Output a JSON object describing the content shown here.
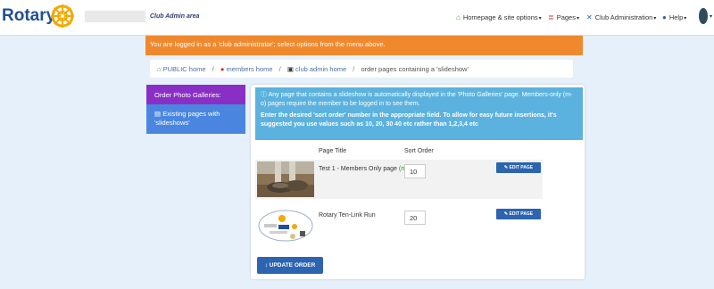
{
  "header": {
    "logo_text": "Rotary",
    "area_label": "Club Admin area",
    "nav": [
      {
        "label": "Homepage & site options",
        "icon": "home-icon"
      },
      {
        "label": "Pages",
        "icon": "stack-icon"
      },
      {
        "label": "Club Administration",
        "icon": "wrench-icon"
      },
      {
        "label": "Help",
        "icon": "question-icon"
      }
    ],
    "colors": {
      "brand": "#1f4e96",
      "wheel": "#f2a900"
    }
  },
  "banner": {
    "text": "You are logged in as a 'club administrator'; select options from the menu above.",
    "color": "#f0892e"
  },
  "breadcrumb": {
    "items": [
      "PUBLIC home",
      "members home",
      "club admin home"
    ],
    "current": "order pages containing a 'slideshow'"
  },
  "sidebar": {
    "heading": "Order Photo Galleries:",
    "item": "Existing pages with 'slideshows'",
    "colors": {
      "heading": "#8a2fc6",
      "item": "#4a86e0"
    }
  },
  "info": {
    "line1": "Any page that contains a slideshow is automatically displayed in the 'Photo Galleries' page. Members-only (m-o) pages require the member to be logged in to see them.",
    "line2": "Enter the desired 'sort order' number in the appropriate field. To allow for easy future insertions, it's suggested you use values such as 10, 20, 30 40 etc rather than 1,2,3,4 etc"
  },
  "table": {
    "headers": {
      "title": "Page Title",
      "sort": "Sort Order"
    },
    "rows": [
      {
        "title": "Test 1 - Members Only page",
        "mo": "(m-o)",
        "sort": "10",
        "button": "EDIT PAGE"
      },
      {
        "title": "Rotary Ten-Link Run",
        "mo": "",
        "sort": "20",
        "button": "EDIT PAGE"
      }
    ]
  },
  "update_button": "UPDATE ORDER"
}
